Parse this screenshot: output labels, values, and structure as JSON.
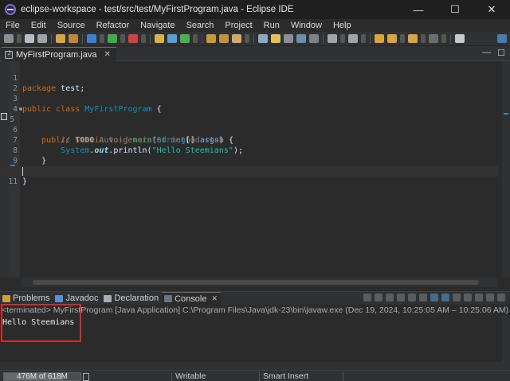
{
  "window": {
    "title": "eclipse-workspace - test/src/test/MyFirstProgram.java - Eclipse IDE",
    "minimize": "—",
    "maximize": "☐",
    "close": "✕"
  },
  "menu": [
    "File",
    "Edit",
    "Source",
    "Refactor",
    "Navigate",
    "Search",
    "Project",
    "Run",
    "Window",
    "Help"
  ],
  "editor": {
    "tab_label": "MyFirstProgram.java",
    "tab_close": "✕",
    "minimize": "—",
    "maximize": "☐",
    "line_numbers": [
      "1",
      "2",
      "3",
      "4",
      "5",
      "6",
      "7",
      "8",
      "9",
      "10",
      "11"
    ],
    "code": {
      "l1_kw": "package",
      "l1_rest": " test;",
      "l3_kw": "public class",
      "l3_cls": "MyFirstProgram",
      "l3_rest": " {",
      "l5_kw": "public static void",
      "l5_mth": "main",
      "l5_p1": "(",
      "l5_type": "String",
      "l5_p2": "[] ",
      "l5_arg": "args",
      "l5_p3": ") {",
      "l6_c1": "// ",
      "l6_todo": "TODO",
      "l6_c2": " Auto-generated method stub",
      "l7_cls": "System",
      "l7_dot1": ".",
      "l7_fld": "out",
      "l7_call": ".println(",
      "l7_str": "\"Hello Steemians\"",
      "l7_end": ");",
      "l8": "}",
      "l10": "}"
    }
  },
  "console": {
    "tabs": [
      "Problems",
      "Javadoc",
      "Declaration",
      "Console"
    ],
    "active_tab": "Console",
    "tab_close": "✕",
    "status": "<terminated> MyFirstProgram [Java Application] C:\\Program Files\\Java\\jdk-23\\bin\\javaw.exe  (Dec 19, 2024, 10:25:05 AM – 10:25:06 AM) [pid: 19740]",
    "output": "Hello Steemians"
  },
  "statusbar": {
    "heap": "476M of 618M",
    "heap_fraction": 0.77,
    "mode": "Writable",
    "insert_mode": "Smart Insert"
  },
  "colors": {
    "background": "#2b2b2b",
    "keyword": "#cc6c1d",
    "class": "#1290c3",
    "method": "#1eb540",
    "string": "#17c6a3",
    "highlight_box": "#d52b2b"
  }
}
